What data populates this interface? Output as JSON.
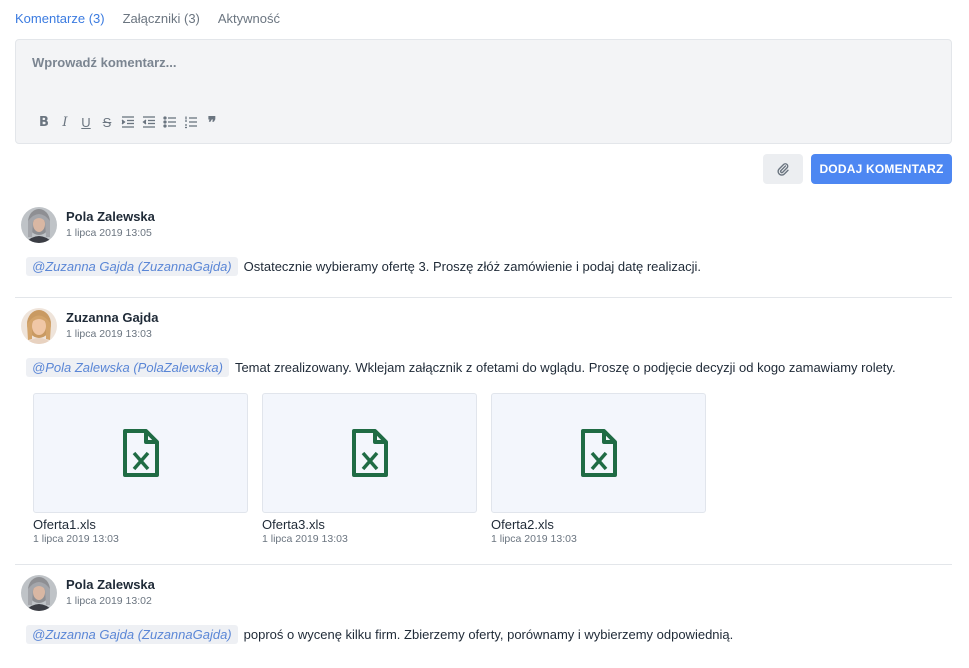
{
  "tabs": [
    {
      "label": "Komentarze (3)",
      "active": true
    },
    {
      "label": "Załączniki (3)",
      "active": false
    },
    {
      "label": "Aktywność",
      "active": false
    }
  ],
  "editor": {
    "placeholder": "Wprowadź komentarz...",
    "toolbar": [
      "bold-icon",
      "italic-icon",
      "underline-icon",
      "strikethrough-icon",
      "indent-icon",
      "outdent-icon",
      "bullet-list-icon",
      "numbered-list-icon",
      "quote-icon"
    ]
  },
  "actions": {
    "attach_icon": "paperclip-icon",
    "add_comment_label": "DODAJ KOMENTARZ"
  },
  "colors": {
    "accent": "#4d87f2",
    "tab_active": "#3b7be0",
    "mention": "#5a86d6",
    "excel_green": "#1f6b44"
  },
  "comments": [
    {
      "author": "Pola Zalewska",
      "date": "1 lipca 2019 13:05",
      "mention": "@Zuzanna Gajda (ZuzannaGajda)",
      "text": "Ostatecznie wybieramy ofertę 3. Proszę złóż zamówienie i podaj datę realizacji."
    },
    {
      "author": "Zuzanna Gajda",
      "date": "1 lipca 2019 13:03",
      "mention": "@Pola Zalewska (PolaZalewska)",
      "text": "Temat zrealizowany. Wklejam załącznik z ofetami do wglądu. Proszę o podjęcie decyzji od kogo zamawiamy rolety.",
      "attachments": [
        {
          "name": "Oferta1.xls",
          "date": "1 lipca 2019 13:03",
          "icon": "excel-file-icon"
        },
        {
          "name": "Oferta3.xls",
          "date": "1 lipca 2019 13:03",
          "icon": "excel-file-icon"
        },
        {
          "name": "Oferta2.xls",
          "date": "1 lipca 2019 13:03",
          "icon": "excel-file-icon"
        }
      ]
    },
    {
      "author": "Pola Zalewska",
      "date": "1 lipca 2019 13:02",
      "mention": "@Zuzanna Gajda (ZuzannaGajda)",
      "text": "poproś o wycenę kilku firm. Zbierzemy oferty, porównamy i wybierzemy odpowiednią."
    }
  ]
}
